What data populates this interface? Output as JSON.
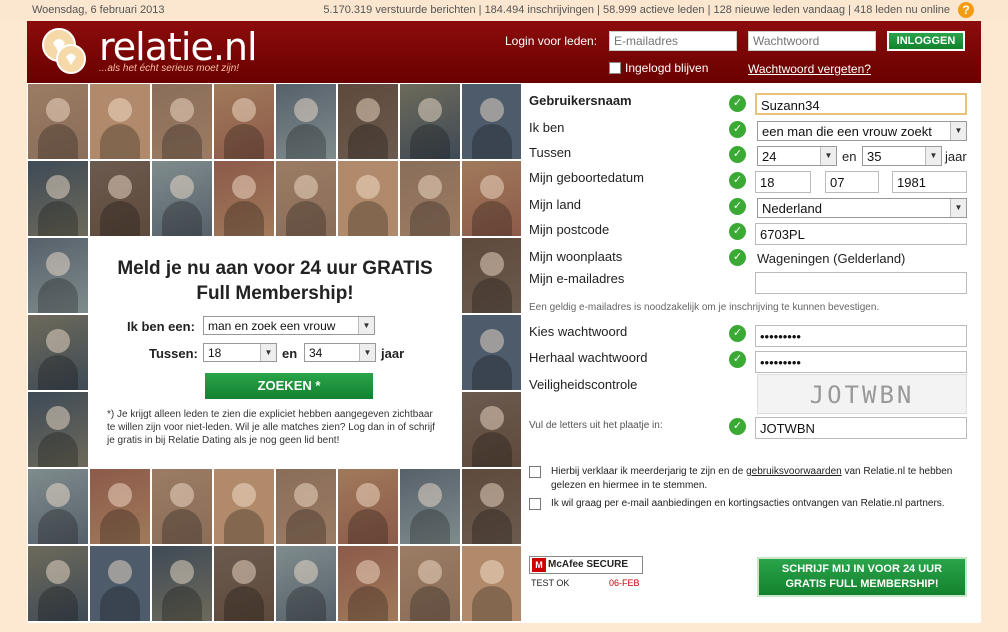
{
  "topbar": {
    "date": "Woensdag, 6 februari 2013",
    "stats": "5.170.319 verstuurde berichten | 184.494 inschrijvingen | 58.999 actieve leden | 128 nieuwe leden vandaag | 418 leden nu online",
    "help": "?"
  },
  "header": {
    "logo_text": "relatie.nl",
    "tagline": "...als het écht serieus moet zijn!",
    "login_label": "Login voor leden:",
    "email_placeholder": "E-mailadres",
    "password_placeholder": "Wachtwoord",
    "login_button": "INLOGGEN",
    "remember_label": "Ingelogd blijven",
    "forgot_link": "Wachtwoord vergeten?"
  },
  "promo": {
    "title_line1": "Meld je nu aan voor 24 uur GRATIS",
    "title_line2": "Full Membership!",
    "ik_ben_label": "Ik ben een:",
    "ik_ben_value": "man en zoek een vrouw",
    "tussen_label": "Tussen:",
    "age_from": "18",
    "en_label": "en",
    "age_to": "34",
    "jaar_label": "jaar",
    "search_button": "ZOEKEN *",
    "note": "*) Je krijgt alleen leden te zien die expliciet hebben aangegeven zichtbaar te willen zijn voor niet-leden. Wil je alle matches zien? Log dan in of schrijf je gratis in bij Relatie Dating als je nog geen lid bent!"
  },
  "form": {
    "username_label": "Gebruikersnaam",
    "username_value": "Suzann34",
    "ik_ben_label": "Ik ben",
    "ik_ben_value": "een man die een vrouw zoekt",
    "tussen_label": "Tussen",
    "age_from": "24",
    "en_label": "en",
    "age_to": "35",
    "jaar_label": "jaar",
    "dob_label": "Mijn geboortedatum",
    "dob_day": "18",
    "dob_month": "07",
    "dob_year": "1981",
    "country_label": "Mijn land",
    "country_value": "Nederland",
    "postcode_label": "Mijn postcode",
    "postcode_value": "6703PL",
    "city_label": "Mijn woonplaats",
    "city_value": "Wageningen (Gelderland)",
    "email_label": "Mijn e-mailadres",
    "email_value": "",
    "email_hint": "Een geldig e-mailadres is noodzakelijk om je inschrijving te kunnen bevestigen.",
    "password_label": "Kies wachtwoord",
    "password_value": "•••••••••",
    "password_repeat_label": "Herhaal wachtwoord",
    "password_repeat_value": "•••••••••",
    "captcha_label": "Veiligheidscontrole",
    "captcha_image_text": "JOTWBN",
    "captcha_hint": "Vul de letters uit het plaatje in:",
    "captcha_value": "JOTWBN",
    "agree1_pre": "Hierbij verklaar ik meerderjarig te zijn en de ",
    "agree1_link": "gebruiksvoorwaarden",
    "agree1_post": " van Relatie.nl te hebben gelezen en hiermee in te stemmen.",
    "agree2": "Ik wil graag per e-mail aanbiedingen en kortingsacties ontvangen van Relatie.nl partners.",
    "mcafee_badge": "McAfee SECURE",
    "mcafee_test": "TEST OK",
    "mcafee_date": "06-FEB",
    "signup_line1": "SCHRIJF MIJ IN VOOR 24 UUR",
    "signup_line2": "GRATIS FULL MEMBERSHIP!"
  },
  "colors": {
    "brand_red": "#7a0404",
    "accent_green": "#1e9a3c",
    "page_bg": "#fde9d2"
  }
}
